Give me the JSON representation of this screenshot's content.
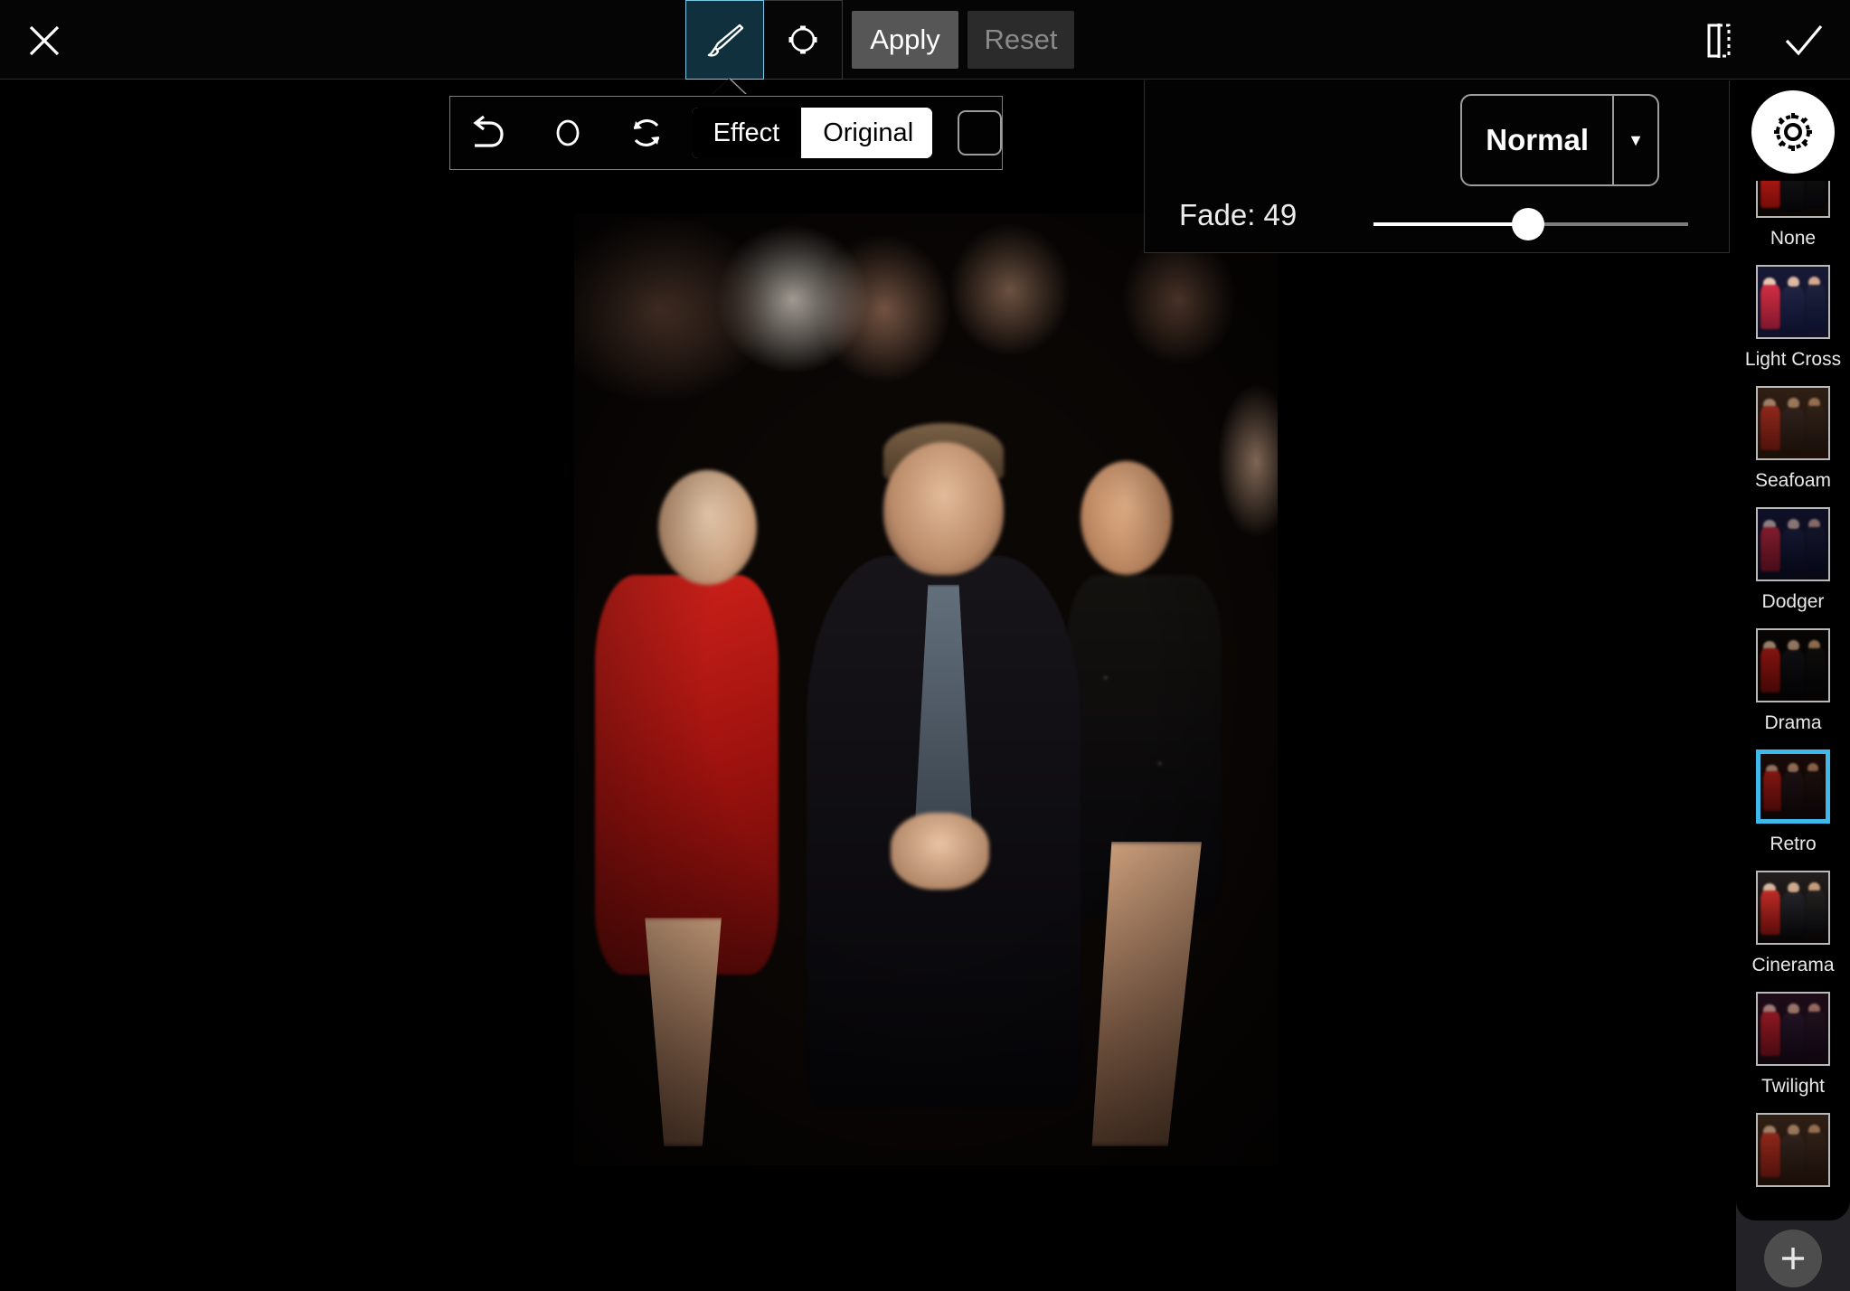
{
  "topbar": {
    "close_icon": "close-icon",
    "tools": [
      {
        "id": "brush",
        "icon": "paintbrush-icon",
        "selected": true
      },
      {
        "id": "shape",
        "icon": "shape-transform-icon",
        "selected": false
      }
    ],
    "apply_label": "Apply",
    "reset_label": "Reset",
    "compare_icon": "before-after-compare-icon",
    "confirm_icon": "checkmark-icon"
  },
  "brush_toolbar": {
    "undo_icon": "undo-arrow-icon",
    "brush_size_icon": "brush-size-circle-icon",
    "reset_icon": "refresh-circular-arrows-icon",
    "segments": [
      {
        "label": "Effect",
        "selected": true
      },
      {
        "label": "Original",
        "selected": false
      }
    ],
    "mask_icon": "rounded-square-mask-icon"
  },
  "blend_panel": {
    "mode_label": "Normal",
    "caret_icon": "chevron-down-icon",
    "fade_label": "Fade: 49",
    "fade_value": 49,
    "fade_min": 0,
    "fade_max": 100
  },
  "sidebar": {
    "settings_icon": "gear-icon",
    "add_icon": "plus-icon",
    "selected_filter": "Retro",
    "accent_color": "#3fb8ec",
    "filters": [
      {
        "label": "None",
        "tint": "tint-none",
        "selected": false,
        "clipped": true
      },
      {
        "label": "Light Cross",
        "tint": "tint-lightcross",
        "selected": false,
        "clipped": false
      },
      {
        "label": "Seafoam",
        "tint": "tint-seafoam",
        "selected": false,
        "clipped": false
      },
      {
        "label": "Dodger",
        "tint": "tint-dodger",
        "selected": false,
        "clipped": false
      },
      {
        "label": "Drama",
        "tint": "tint-drama",
        "selected": false,
        "clipped": false
      },
      {
        "label": "Retro",
        "tint": "tint-retro",
        "selected": true,
        "clipped": false
      },
      {
        "label": "Cinerama",
        "tint": "tint-cinerama",
        "selected": false,
        "clipped": false
      },
      {
        "label": "Twilight",
        "tint": "tint-twilight",
        "selected": false,
        "clipped": false
      },
      {
        "label": "",
        "tint": "tint-seafoam",
        "selected": false,
        "clipped": true
      }
    ]
  },
  "canvas": {
    "image_name": "group-photo-three-people-seated"
  }
}
